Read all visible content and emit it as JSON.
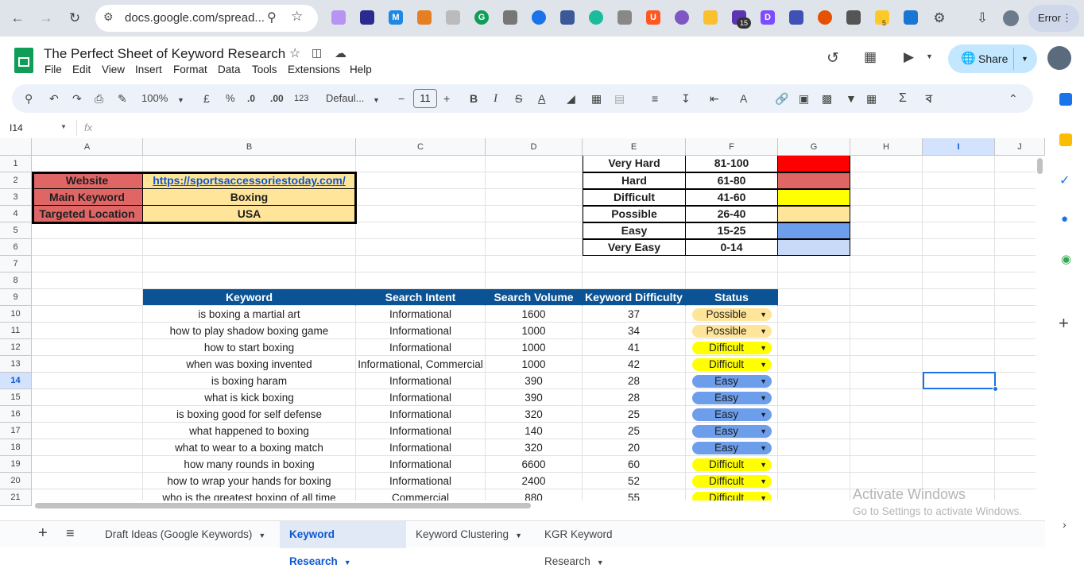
{
  "browser": {
    "url": "docs.google.com/spread...",
    "error_label": "Error",
    "ext_badge_1": "15",
    "ext_badge_2": "5"
  },
  "doc": {
    "title": "The Perfect Sheet of Keyword Research",
    "menu": [
      "File",
      "Edit",
      "View",
      "Insert",
      "Format",
      "Data",
      "Tools",
      "Extensions",
      "Help"
    ],
    "share_label": "Share"
  },
  "toolbar": {
    "zoom": "100%",
    "currency": "£",
    "percent": "%",
    "dec_dec": ".0",
    "dec_inc": ".00",
    "number_format": "123",
    "font": "Defaul...",
    "font_size": "11"
  },
  "formula_bar": {
    "name_box": "I14",
    "fx": "fx",
    "value": ""
  },
  "columns": [
    "A",
    "B",
    "C",
    "D",
    "E",
    "F",
    "G",
    "H",
    "I",
    "J"
  ],
  "rows": [
    "1",
    "2",
    "3",
    "4",
    "5",
    "6",
    "7",
    "8",
    "9",
    "10",
    "11",
    "12",
    "13",
    "14",
    "15",
    "16",
    "17",
    "18",
    "19",
    "20",
    "21"
  ],
  "info": [
    {
      "label": "Website",
      "value": "https://sportsaccessoriestoday.com/"
    },
    {
      "label": "Main Keyword",
      "value": "Boxing"
    },
    {
      "label": "Targeted Location",
      "value": "USA"
    }
  ],
  "legend": [
    {
      "level": "Very Hard",
      "range": "81-100",
      "color": "#ff0000"
    },
    {
      "level": "Hard",
      "range": "61-80",
      "color": "#e06666"
    },
    {
      "level": "Difficult",
      "range": "41-60",
      "color": "#ffff00"
    },
    {
      "level": "Possible",
      "range": "26-40",
      "color": "#ffe599"
    },
    {
      "level": "Easy",
      "range": "15-25",
      "color": "#6d9eeb"
    },
    {
      "level": "Very Easy",
      "range": "0-14",
      "color": "#c9daf8"
    }
  ],
  "table": {
    "headers": [
      "Keyword",
      "Search Intent",
      "Search Volume",
      "Keyword Difficulty",
      "Status"
    ],
    "rows": [
      {
        "keyword": "is boxing a martial art",
        "intent": "Informational",
        "volume": "1600",
        "kd": "37",
        "status": "Possible"
      },
      {
        "keyword": "how to play shadow boxing game",
        "intent": "Informational",
        "volume": "1000",
        "kd": "34",
        "status": "Possible"
      },
      {
        "keyword": "how to start boxing",
        "intent": "Informational",
        "volume": "1000",
        "kd": "41",
        "status": "Difficult"
      },
      {
        "keyword": "when was boxing invented",
        "intent": "Informational, Commercial",
        "volume": "1000",
        "kd": "42",
        "status": "Difficult"
      },
      {
        "keyword": "is boxing haram",
        "intent": "Informational",
        "volume": "390",
        "kd": "28",
        "status": "Easy"
      },
      {
        "keyword": "what is kick boxing",
        "intent": "Informational",
        "volume": "390",
        "kd": "28",
        "status": "Easy"
      },
      {
        "keyword": "is boxing good for self defense",
        "intent": "Informational",
        "volume": "320",
        "kd": "25",
        "status": "Easy"
      },
      {
        "keyword": "what happened to boxing",
        "intent": "Informational",
        "volume": "140",
        "kd": "25",
        "status": "Easy"
      },
      {
        "keyword": "what to wear to a boxing match",
        "intent": "Informational",
        "volume": "320",
        "kd": "20",
        "status": "Easy"
      },
      {
        "keyword": "how many rounds in boxing",
        "intent": "Informational",
        "volume": "6600",
        "kd": "60",
        "status": "Difficult"
      },
      {
        "keyword": "how to wrap your hands for boxing",
        "intent": "Informational",
        "volume": "2400",
        "kd": "52",
        "status": "Difficult"
      },
      {
        "keyword": "who is the greatest boxing of all time",
        "intent": "Commercial",
        "volume": "880",
        "kd": "55",
        "status": "Difficult"
      }
    ]
  },
  "status_colors": {
    "Possible": "#ffe599",
    "Difficult": "#ffff00",
    "Easy": "#6d9eeb"
  },
  "watermark": {
    "line1": "Activate Windows",
    "line2": "Go to Settings to activate Windows."
  },
  "sheets": [
    {
      "name": "Draft Ideas (Google Keywords)",
      "active": false
    },
    {
      "name": "Keyword Research",
      "active": true
    },
    {
      "name": "Keyword Clustering",
      "active": false
    },
    {
      "name": "KGR Keyword Research",
      "active": false
    }
  ],
  "colors": {
    "header_blue": "#0b5394",
    "label_red": "#e06666",
    "value_yellow": "#ffe599",
    "selection": "#1a73e8"
  }
}
